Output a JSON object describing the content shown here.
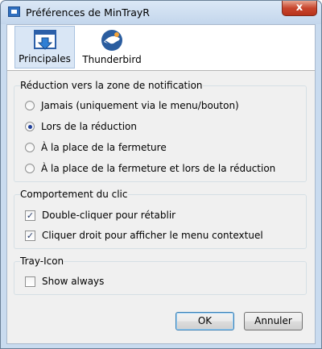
{
  "window": {
    "title": "Préférences de MinTrayR",
    "close_label": "x"
  },
  "tabs": [
    {
      "label": "Principales",
      "selected": true,
      "icon": "window-minimize-tray-icon"
    },
    {
      "label": "Thunderbird",
      "selected": false,
      "icon": "thunderbird-logo-icon"
    }
  ],
  "minimize_group": {
    "title": "Réduction vers la zone de notification",
    "options": [
      {
        "label": "Jamais (uniquement via le menu/bouton)",
        "checked": false
      },
      {
        "label": "Lors de la réduction",
        "checked": true
      },
      {
        "label": "À la place de la fermeture",
        "checked": false
      },
      {
        "label": "À la place de la fermeture et lors de la réduction",
        "checked": false
      }
    ]
  },
  "click_group": {
    "title": "Comportement du clic",
    "options": [
      {
        "label": "Double-cliquer pour rétablir",
        "checked": true
      },
      {
        "label": "Cliquer droit pour afficher le menu contextuel",
        "checked": true
      }
    ]
  },
  "tray_group": {
    "title": "Tray-Icon",
    "options": [
      {
        "label": "Show always",
        "checked": false
      }
    ]
  },
  "buttons": {
    "ok": "OK",
    "cancel": "Annuler"
  },
  "colors": {
    "accent": "#3c7fb1",
    "close": "#c8462e",
    "frame": "#c9dbef"
  }
}
